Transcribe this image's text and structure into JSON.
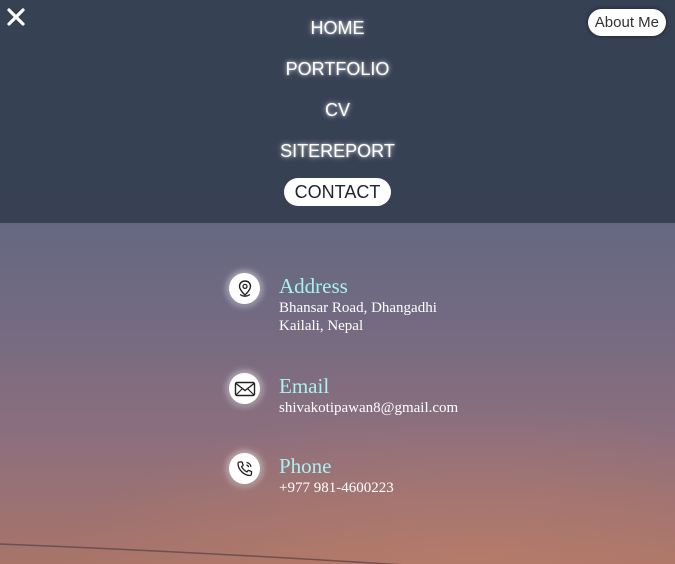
{
  "menu": {
    "close_icon": "close-icon",
    "about_label": "About Me",
    "items": [
      {
        "label": "HOME",
        "active": false
      },
      {
        "label": "PORTFOLIO",
        "active": false
      },
      {
        "label": "CV",
        "active": false
      },
      {
        "label": "SITEREPORT",
        "active": false
      },
      {
        "label": "CONTACT",
        "active": true
      }
    ]
  },
  "contact": {
    "address": {
      "icon": "location-pin-icon",
      "title": "Address",
      "lines": [
        "Bhansar Road, Dhangadhi",
        "Kailali, Nepal"
      ]
    },
    "email": {
      "icon": "envelope-icon",
      "title": "Email",
      "value": "shivakotipawan8@gmail.com"
    },
    "phone": {
      "icon": "phone-icon",
      "title": "Phone",
      "value": "+977 981-4600223"
    }
  },
  "colors": {
    "menu_bg": "#343e50",
    "title_accent": "#a8f2f0",
    "text": "#ffffff"
  }
}
